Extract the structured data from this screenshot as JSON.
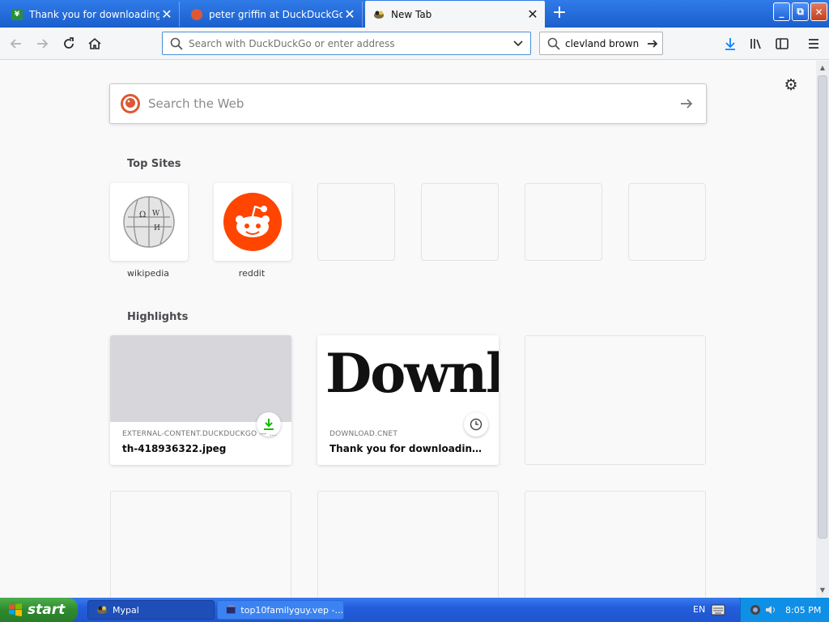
{
  "tabs": [
    {
      "title": "Thank you for downloading AVS Vi",
      "favicon": "cnet-favicon",
      "active": false
    },
    {
      "title": "peter griffin at DuckDuckGo",
      "favicon": "duckduckgo-favicon",
      "active": false
    },
    {
      "title": "New Tab",
      "favicon": "browser-favicon",
      "active": true
    }
  ],
  "tab_close_glyph": "✕",
  "new_tab_glyph": "+",
  "window_controls": {
    "minimize": "_",
    "maximize": "⧉",
    "close": "✕"
  },
  "navbar": {
    "url_placeholder": "Search with DuckDuckGo or enter address",
    "url_value": "",
    "search_value": "clevland brown"
  },
  "newtab": {
    "search_placeholder": "Search the Web",
    "top_sites_title": "Top Sites",
    "top_sites": [
      {
        "label": "wikipedia",
        "icon": "wikipedia-globe"
      },
      {
        "label": "reddit",
        "icon": "reddit-alien"
      }
    ],
    "highlights_title": "Highlights",
    "highlights": [
      {
        "context": "EXTERNAL-CONTENT.DUCKDUCKGO — 2...",
        "title": "th-418936322.jpeg",
        "badge": "download-icon"
      },
      {
        "context": "DOWNLOAD.CNET",
        "title": "Thank you for downloading AVS ...",
        "preview_text": "Downl",
        "badge": "history-clock-icon"
      }
    ]
  },
  "taskbar": {
    "start_label": "start",
    "tasks": [
      {
        "label": "Mypal"
      },
      {
        "label": "top10familyguy.vep -..."
      }
    ],
    "language": "EN",
    "clock": "8:05 PM"
  },
  "colors": {
    "titlebar_blue": "#1b5fcc",
    "accent_blue": "#0a84ff",
    "reddit_orange": "#ff4500",
    "download_green": "#12bc00"
  }
}
